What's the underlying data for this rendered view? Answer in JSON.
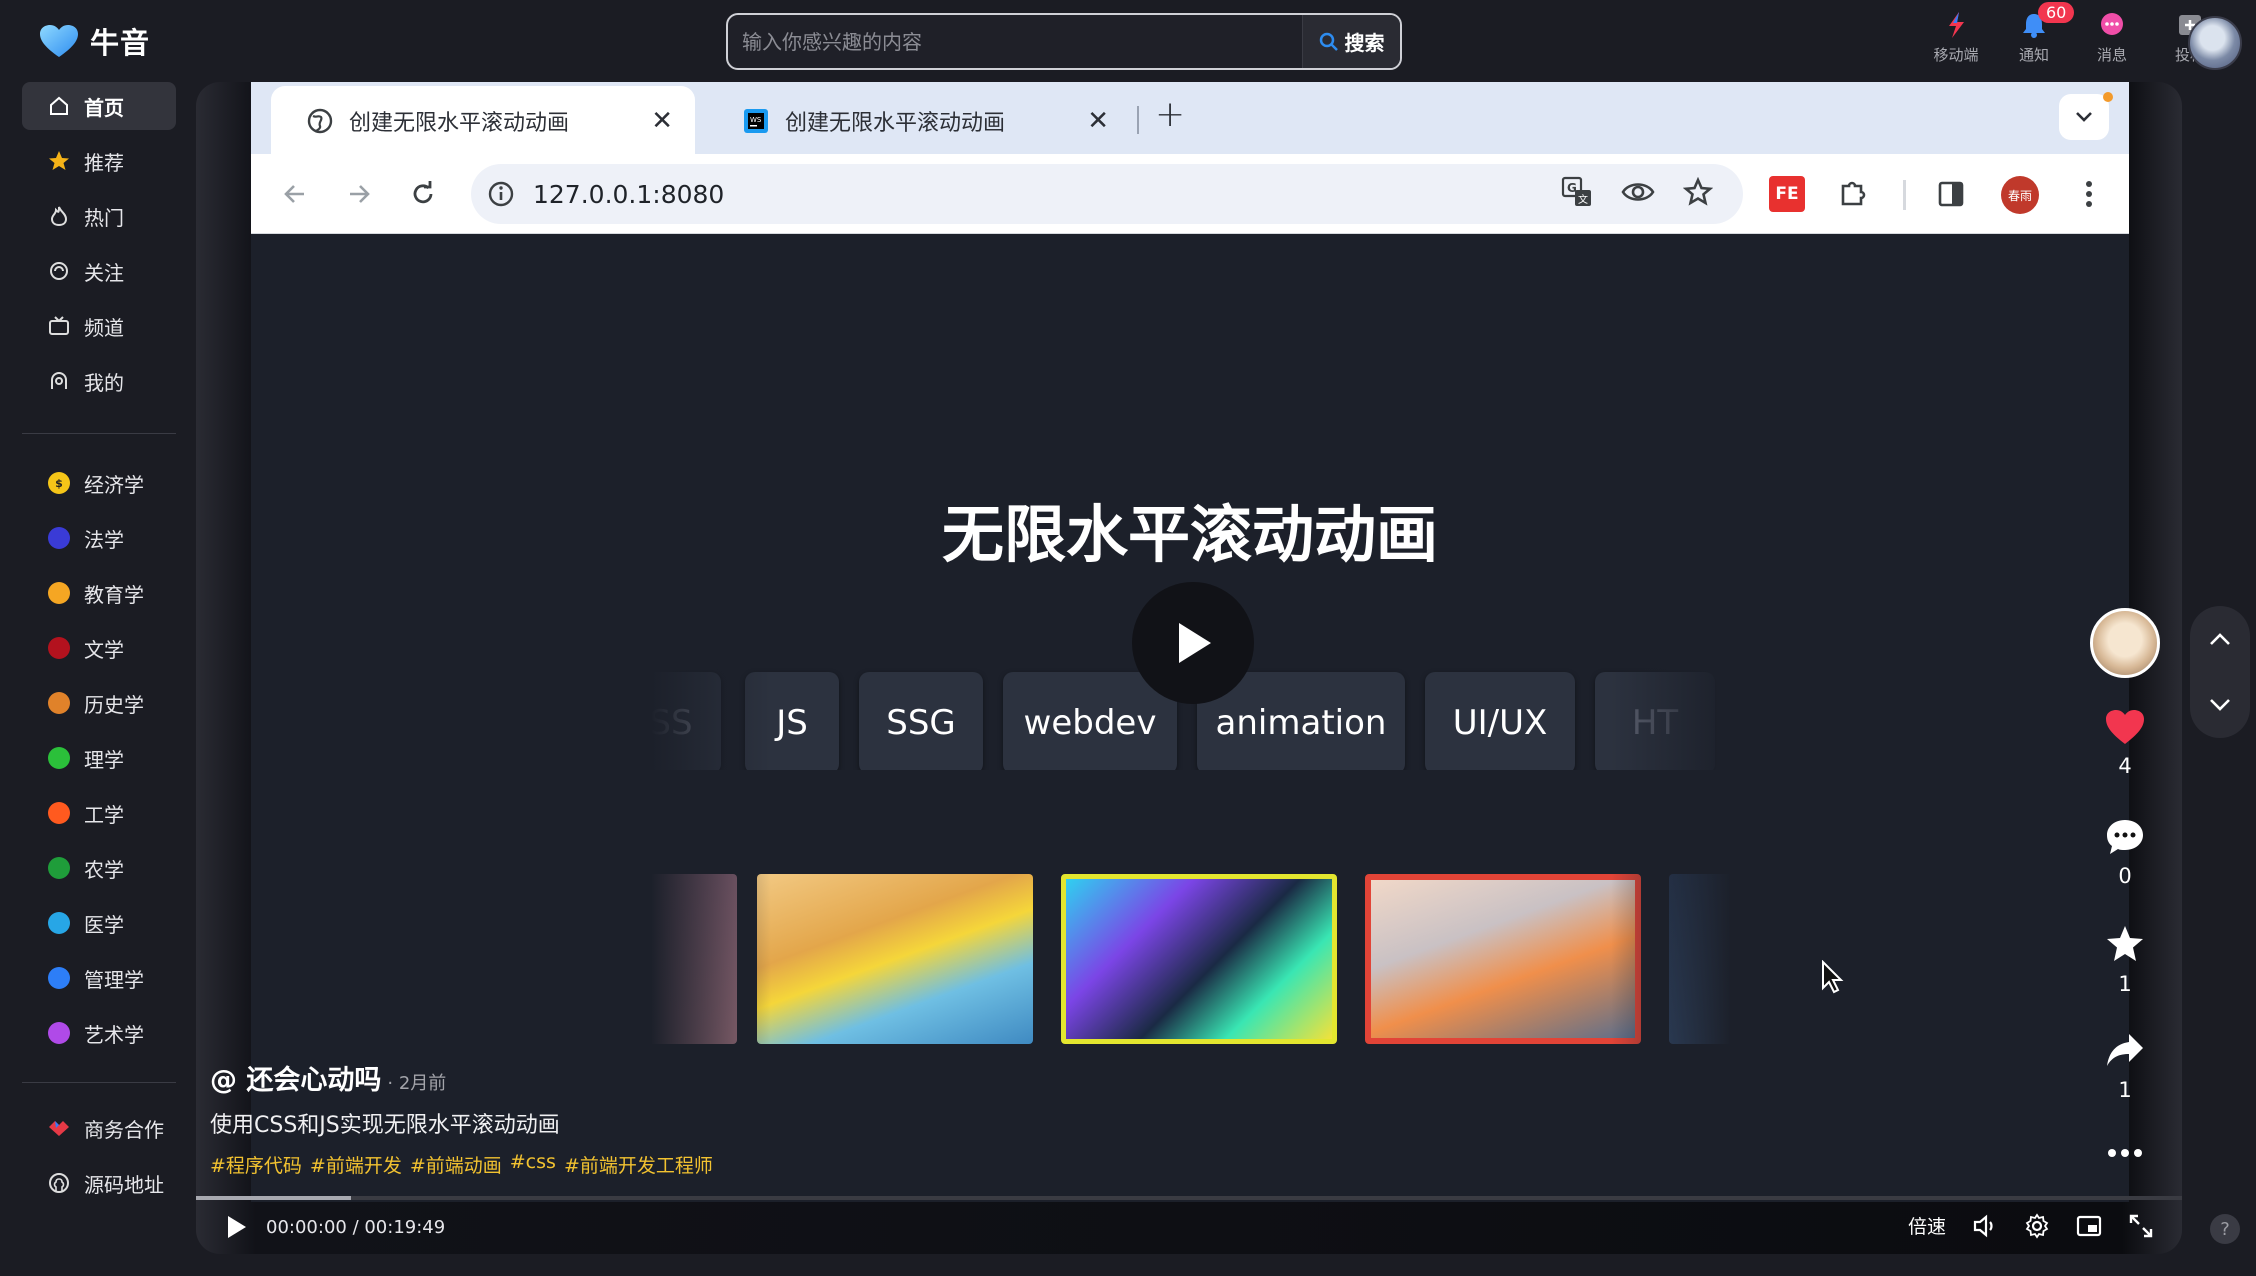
{
  "app": {
    "name": "牛音"
  },
  "search": {
    "placeholder": "输入你感兴趣的内容",
    "button": "搜索"
  },
  "top_actions": [
    {
      "icon": "mobile-icon",
      "label": "移动端"
    },
    {
      "icon": "bell-icon",
      "label": "通知",
      "badge": "60"
    },
    {
      "icon": "message-icon",
      "label": "消息"
    },
    {
      "icon": "upload-icon",
      "label": "投稿"
    }
  ],
  "sidebar": {
    "main": [
      {
        "icon": "home-icon",
        "label": "首页",
        "active": true
      },
      {
        "icon": "star-icon",
        "label": "推荐"
      },
      {
        "icon": "fire-icon",
        "label": "热门"
      },
      {
        "icon": "follow-icon",
        "label": "关注"
      },
      {
        "icon": "tv-icon",
        "label": "频道"
      },
      {
        "icon": "user-icon",
        "label": "我的"
      }
    ],
    "categories": [
      {
        "label": "经济学",
        "color": "#f5c518"
      },
      {
        "label": "法学",
        "color": "#3a3bd6"
      },
      {
        "label": "教育学",
        "color": "#f5a623"
      },
      {
        "label": "文学",
        "color": "#b3121e"
      },
      {
        "label": "历史学",
        "color": "#e0822a"
      },
      {
        "label": "理学",
        "color": "#2bc03a"
      },
      {
        "label": "工学",
        "color": "#ff5a1f"
      },
      {
        "label": "农学",
        "color": "#1f9d3a"
      },
      {
        "label": "医学",
        "color": "#27a6e6"
      },
      {
        "label": "管理学",
        "color": "#2d7ef7"
      },
      {
        "label": "艺术学",
        "color": "#b04ae8"
      }
    ],
    "footer": [
      {
        "icon": "handshake-icon",
        "label": "商务合作"
      },
      {
        "icon": "github-icon",
        "label": "源码地址"
      }
    ]
  },
  "browser": {
    "tabs": [
      {
        "title": "创建无限水平滚动动画",
        "favicon": "globe-icon",
        "active": true
      },
      {
        "title": "创建无限水平滚动动画",
        "favicon": "webstorm-icon",
        "active": false
      }
    ],
    "url": "127.0.0.1:8080",
    "profile_label": "春雨",
    "ext_label": "FE"
  },
  "page": {
    "title": "无限水平滚动动画",
    "chips": [
      "SS",
      "JS",
      "SSG",
      "webdev",
      "animation",
      "UI/UX",
      "HT"
    ]
  },
  "video": {
    "author": "@ 还会心动吗",
    "time_ago": "· 2月前",
    "description": "使用CSS和JS实现无限水平滚动动画",
    "tags": [
      "#程序代码",
      "#前端开发",
      "#前端动画",
      "#css",
      "#前端开发工程师"
    ],
    "timecode": "00:00:00 / 00:19:49",
    "speed_label": "倍速",
    "progress_fraction": 0.078,
    "counts": {
      "likes": "4",
      "comments": "0",
      "favorites": "1",
      "shares": "1"
    }
  },
  "colors": {
    "accent_yellow": "#f2c230",
    "like_red": "#f2364f",
    "bg": "#1b1c23"
  }
}
